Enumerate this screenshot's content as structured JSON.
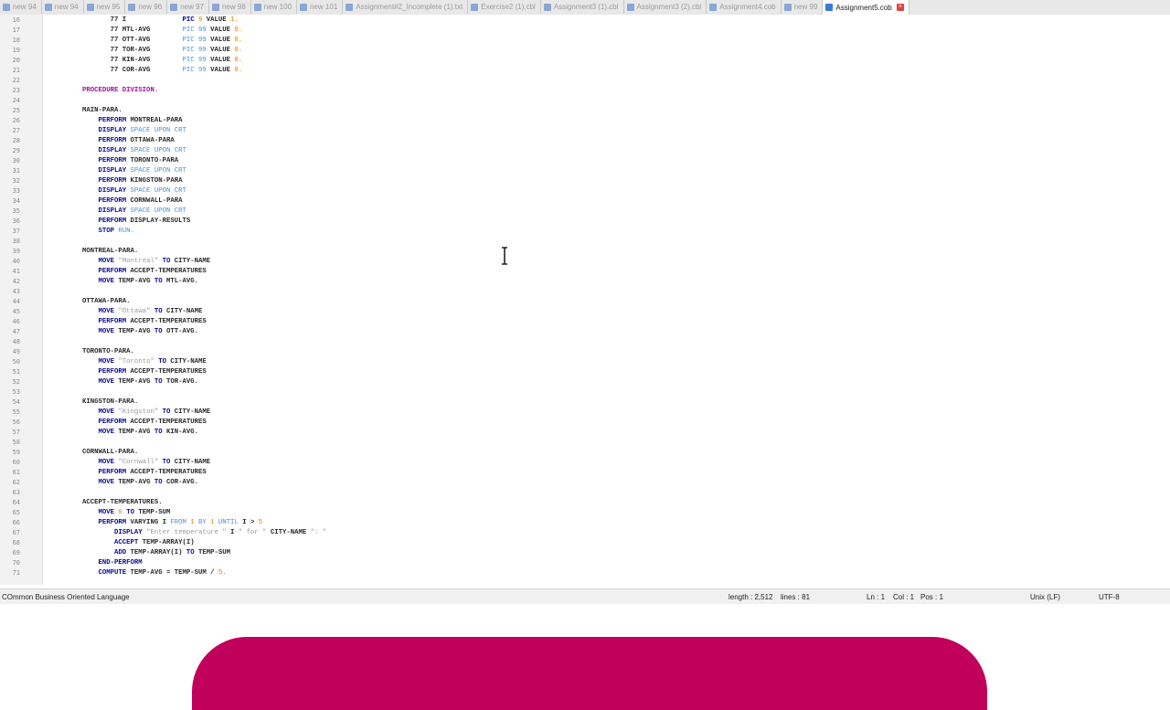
{
  "tabs": [
    {
      "label": "new 94",
      "icon": "file-icon",
      "active": false
    },
    {
      "label": "new 94",
      "icon": "file-icon",
      "active": false
    },
    {
      "label": "new 95",
      "icon": "file-icon",
      "active": false
    },
    {
      "label": "new 96",
      "icon": "file-icon",
      "active": false
    },
    {
      "label": "new 97",
      "icon": "file-icon",
      "active": false
    },
    {
      "label": "new 98",
      "icon": "file-icon",
      "active": false
    },
    {
      "label": "new 100",
      "icon": "file-icon",
      "active": false
    },
    {
      "label": "new 101",
      "icon": "file-icon",
      "active": false
    },
    {
      "label": "Assignment#2_Incomplete (1).txt",
      "icon": "file-icon",
      "active": false
    },
    {
      "label": "Exercise2 (1).cbl",
      "icon": "file-icon",
      "active": false
    },
    {
      "label": "Assignment3 (1).cbl",
      "icon": "file-icon",
      "active": false
    },
    {
      "label": "Assignment3 (2).cbl",
      "icon": "file-icon",
      "active": false
    },
    {
      "label": "Assignment4.cob",
      "icon": "file-icon",
      "active": false
    },
    {
      "label": "new 99",
      "icon": "file-icon",
      "active": false
    },
    {
      "label": "Assignment5.cob",
      "icon": "file-icon",
      "active": true
    }
  ],
  "colors": {
    "keyword": "#0b0b8f",
    "string": "#9a9a9a",
    "number": "#e07a00",
    "literal": "#4a90d9",
    "division": "#a010a0",
    "banner": "#c0005a",
    "close": "#e04040"
  },
  "code_lines": [
    {
      "n": "16",
      "parts": [
        [
          "",
          "       77 I              "
        ],
        [
          "kw",
          "PIC "
        ],
        [
          "num",
          "9"
        ],
        [
          "",
          " VALUE "
        ],
        [
          "num",
          "1."
        ]
      ]
    },
    {
      "n": "17",
      "parts": [
        [
          "",
          "       77 MTL-AVG        "
        ],
        [
          "lt",
          "PIC 99"
        ],
        [
          "",
          " VALUE "
        ],
        [
          "num",
          "0."
        ]
      ]
    },
    {
      "n": "18",
      "parts": [
        [
          "",
          "       77 OTT-AVG        "
        ],
        [
          "lt",
          "PIC 99"
        ],
        [
          "",
          " VALUE "
        ],
        [
          "num",
          "0."
        ]
      ]
    },
    {
      "n": "19",
      "parts": [
        [
          "",
          "       77 TOR-AVG        "
        ],
        [
          "lt",
          "PIC 99"
        ],
        [
          "",
          " VALUE "
        ],
        [
          "num",
          "0."
        ]
      ]
    },
    {
      "n": "20",
      "parts": [
        [
          "",
          "       77 KIN-AVG        "
        ],
        [
          "lt",
          "PIC 99"
        ],
        [
          "",
          " VALUE "
        ],
        [
          "num",
          "0."
        ]
      ]
    },
    {
      "n": "21",
      "parts": [
        [
          "",
          "       77 COR-AVG        "
        ],
        [
          "lt",
          "PIC 99"
        ],
        [
          "",
          " VALUE "
        ],
        [
          "num",
          "0."
        ]
      ]
    },
    {
      "n": "22",
      "parts": []
    },
    {
      "n": "23",
      "parts": [
        [
          "div",
          "PROCEDURE DIVISION."
        ]
      ]
    },
    {
      "n": "24",
      "parts": []
    },
    {
      "n": "25",
      "parts": [
        [
          "",
          "MAIN-PARA."
        ]
      ]
    },
    {
      "n": "26",
      "parts": [
        [
          "kw",
          "    PERFORM "
        ],
        [
          "",
          "MONTREAL-PARA"
        ]
      ]
    },
    {
      "n": "27",
      "parts": [
        [
          "kw",
          "    DISPLAY "
        ],
        [
          "lt",
          "SPACE UPON CRT"
        ]
      ]
    },
    {
      "n": "28",
      "parts": [
        [
          "kw",
          "    PERFORM "
        ],
        [
          "",
          "OTTAWA-PARA"
        ]
      ]
    },
    {
      "n": "29",
      "parts": [
        [
          "kw",
          "    DISPLAY "
        ],
        [
          "lt",
          "SPACE UPON CRT"
        ]
      ]
    },
    {
      "n": "30",
      "parts": [
        [
          "kw",
          "    PERFORM "
        ],
        [
          "",
          "TORONTO-PARA"
        ]
      ]
    },
    {
      "n": "31",
      "parts": [
        [
          "kw",
          "    DISPLAY "
        ],
        [
          "lt",
          "SPACE UPON CRT"
        ]
      ]
    },
    {
      "n": "32",
      "parts": [
        [
          "kw",
          "    PERFORM "
        ],
        [
          "",
          "KINGSTON-PARA"
        ]
      ]
    },
    {
      "n": "33",
      "parts": [
        [
          "kw",
          "    DISPLAY "
        ],
        [
          "lt",
          "SPACE UPON CRT"
        ]
      ]
    },
    {
      "n": "34",
      "parts": [
        [
          "kw",
          "    PERFORM "
        ],
        [
          "",
          "CORNWALL-PARA"
        ]
      ]
    },
    {
      "n": "35",
      "parts": [
        [
          "kw",
          "    DISPLAY "
        ],
        [
          "lt",
          "SPACE UPON CRT"
        ]
      ]
    },
    {
      "n": "36",
      "parts": [
        [
          "kw",
          "    PERFORM "
        ],
        [
          "",
          "DISPLAY-RESULTS"
        ]
      ]
    },
    {
      "n": "37",
      "parts": [
        [
          "kw",
          "    STOP "
        ],
        [
          "lt",
          "RUN."
        ]
      ]
    },
    {
      "n": "38",
      "parts": []
    },
    {
      "n": "39",
      "parts": [
        [
          "",
          "MONTREAL-PARA."
        ]
      ]
    },
    {
      "n": "40",
      "parts": [
        [
          "kw",
          "    MOVE "
        ],
        [
          "str",
          "\"Montreal\""
        ],
        [
          "kw",
          " TO "
        ],
        [
          "",
          "CITY-NAME"
        ]
      ]
    },
    {
      "n": "41",
      "parts": [
        [
          "kw",
          "    PERFORM "
        ],
        [
          "",
          "ACCEPT-TEMPERATURES"
        ]
      ]
    },
    {
      "n": "42",
      "parts": [
        [
          "kw",
          "    MOVE "
        ],
        [
          "",
          "TEMP-AVG "
        ],
        [
          "kw",
          "TO "
        ],
        [
          "",
          "MTL-AVG."
        ]
      ]
    },
    {
      "n": "43",
      "parts": []
    },
    {
      "n": "44",
      "parts": [
        [
          "",
          "OTTAWA-PARA."
        ]
      ]
    },
    {
      "n": "45",
      "parts": [
        [
          "kw",
          "    MOVE "
        ],
        [
          "str",
          "\"Ottawa\""
        ],
        [
          "kw",
          " TO "
        ],
        [
          "",
          "CITY-NAME"
        ]
      ]
    },
    {
      "n": "46",
      "parts": [
        [
          "kw",
          "    PERFORM "
        ],
        [
          "",
          "ACCEPT-TEMPERATURES"
        ]
      ]
    },
    {
      "n": "47",
      "parts": [
        [
          "kw",
          "    MOVE "
        ],
        [
          "",
          "TEMP-AVG "
        ],
        [
          "kw",
          "TO "
        ],
        [
          "",
          "OTT-AVG."
        ]
      ]
    },
    {
      "n": "48",
      "parts": []
    },
    {
      "n": "49",
      "parts": [
        [
          "",
          "TORONTO-PARA."
        ]
      ]
    },
    {
      "n": "50",
      "parts": [
        [
          "kw",
          "    MOVE "
        ],
        [
          "str",
          "\"Toronto\""
        ],
        [
          "kw",
          " TO "
        ],
        [
          "",
          "CITY-NAME"
        ]
      ]
    },
    {
      "n": "51",
      "parts": [
        [
          "kw",
          "    PERFORM "
        ],
        [
          "",
          "ACCEPT-TEMPERATURES"
        ]
      ]
    },
    {
      "n": "52",
      "parts": [
        [
          "kw",
          "    MOVE "
        ],
        [
          "",
          "TEMP-AVG "
        ],
        [
          "kw",
          "TO "
        ],
        [
          "",
          "TOR-AVG."
        ]
      ]
    },
    {
      "n": "53",
      "parts": []
    },
    {
      "n": "54",
      "parts": [
        [
          "",
          "KINGSTON-PARA."
        ]
      ]
    },
    {
      "n": "55",
      "parts": [
        [
          "kw",
          "    MOVE "
        ],
        [
          "str",
          "\"Kingston\""
        ],
        [
          "kw",
          " TO "
        ],
        [
          "",
          "CITY-NAME"
        ]
      ]
    },
    {
      "n": "56",
      "parts": [
        [
          "kw",
          "    PERFORM "
        ],
        [
          "",
          "ACCEPT-TEMPERATURES"
        ]
      ]
    },
    {
      "n": "57",
      "parts": [
        [
          "kw",
          "    MOVE "
        ],
        [
          "",
          "TEMP-AVG "
        ],
        [
          "kw",
          "TO "
        ],
        [
          "",
          "KIN-AVG."
        ]
      ]
    },
    {
      "n": "58",
      "parts": []
    },
    {
      "n": "59",
      "parts": [
        [
          "",
          "CORNWALL-PARA."
        ]
      ]
    },
    {
      "n": "60",
      "parts": [
        [
          "kw",
          "    MOVE "
        ],
        [
          "str",
          "\"Cornwall\""
        ],
        [
          "kw",
          " TO "
        ],
        [
          "",
          "CITY-NAME"
        ]
      ]
    },
    {
      "n": "61",
      "parts": [
        [
          "kw",
          "    PERFORM "
        ],
        [
          "",
          "ACCEPT-TEMPERATURES"
        ]
      ]
    },
    {
      "n": "62",
      "parts": [
        [
          "kw",
          "    MOVE "
        ],
        [
          "",
          "TEMP-AVG "
        ],
        [
          "kw",
          "TO "
        ],
        [
          "",
          "COR-AVG."
        ]
      ]
    },
    {
      "n": "63",
      "parts": []
    },
    {
      "n": "64",
      "parts": [
        [
          "",
          "ACCEPT-TEMPERATURES."
        ]
      ]
    },
    {
      "n": "65",
      "parts": [
        [
          "kw",
          "    MOVE "
        ],
        [
          "num",
          "0"
        ],
        [
          "kw",
          " TO "
        ],
        [
          "",
          "TEMP-SUM"
        ]
      ]
    },
    {
      "n": "66",
      "parts": [
        [
          "kw",
          "    PERFORM "
        ],
        [
          "",
          "VARYING I "
        ],
        [
          "lt",
          "FROM "
        ],
        [
          "num",
          "1"
        ],
        [
          "lt",
          " BY "
        ],
        [
          "num",
          "1"
        ],
        [
          "lt",
          " UNTIL "
        ],
        [
          "",
          "I > "
        ],
        [
          "num",
          "5"
        ]
      ]
    },
    {
      "n": "67",
      "parts": [
        [
          "kw",
          "        DISPLAY "
        ],
        [
          "str",
          "\"Enter temperature \""
        ],
        [
          "",
          " I "
        ],
        [
          "str",
          "\" for \""
        ],
        [
          "",
          " CITY-NAME "
        ],
        [
          "str",
          "\": \""
        ]
      ]
    },
    {
      "n": "68",
      "parts": [
        [
          "kw",
          "        ACCEPT "
        ],
        [
          "",
          "TEMP-ARRAY(I)"
        ]
      ]
    },
    {
      "n": "69",
      "parts": [
        [
          "kw",
          "        ADD "
        ],
        [
          "",
          "TEMP-ARRAY(I) "
        ],
        [
          "kw",
          "TO "
        ],
        [
          "",
          "TEMP-SUM"
        ]
      ]
    },
    {
      "n": "70",
      "parts": [
        [
          "kw",
          "    END-PERFORM"
        ]
      ]
    },
    {
      "n": "71",
      "parts": [
        [
          "kw",
          "    COMPUTE "
        ],
        [
          "",
          "TEMP-AVG = TEMP-SUM / "
        ],
        [
          "num",
          "5."
        ]
      ]
    }
  ],
  "status": {
    "language": "COmmon Business Oriented Language",
    "length": "length : 2,512",
    "lines": "lines : 81",
    "ln": "Ln : 1",
    "col": "Col : 1",
    "pos": "Pos : 1",
    "eol": "Unix (LF)",
    "encoding": "UTF-8"
  }
}
